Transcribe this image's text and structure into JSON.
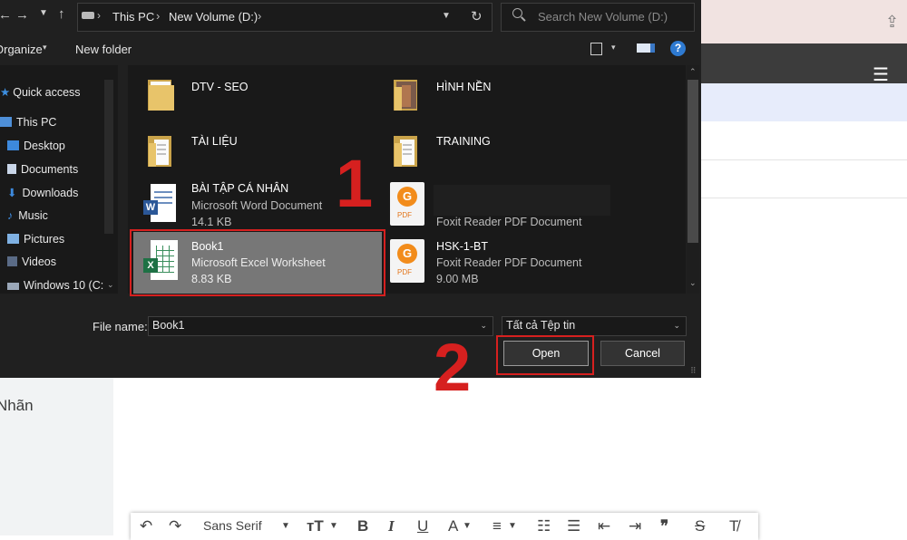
{
  "dialog": {
    "breadcrumb": [
      "This PC",
      "New Volume (D:)"
    ],
    "search_placeholder": "Search New Volume (D:)",
    "toolbar": {
      "organize": "Organize",
      "new_folder": "New folder"
    },
    "nav_items": [
      "Quick access",
      "This PC",
      "Desktop",
      "Documents",
      "Downloads",
      "Music",
      "Pictures",
      "Videos",
      "Windows 10 (C:"
    ],
    "files": [
      {
        "name": "DTV - SEO"
      },
      {
        "name": "HÌNH NỀN"
      },
      {
        "name": "TÀI LIỆU"
      },
      {
        "name": "TRAINING"
      },
      {
        "name": "BÀI TẬP CÁ NHÂN",
        "type": "Microsoft Word Document",
        "size": "14.1 KB"
      },
      {
        "name": "",
        "type": "Foxit Reader PDF Document",
        "size": ""
      },
      {
        "name": "Book1",
        "type": "Microsoft Excel Worksheet",
        "size": "8.83 KB"
      },
      {
        "name": "HSK-1-BT",
        "type": "Foxit Reader PDF Document",
        "size": "9.00 MB"
      }
    ],
    "file_name_label": "File name:",
    "file_name_value": "Book1",
    "file_type_value": "Tất cả Tệp tin",
    "open_label": "Open",
    "cancel_label": "Cancel",
    "pdf_icon_text": "PDF",
    "word_icon_letter": "W",
    "excel_icon_letter": "X"
  },
  "annotations": {
    "step1": "1",
    "step2": "2"
  },
  "background": {
    "side_label": "Nhãn",
    "format_bar": {
      "font_name": "Sans Serif"
    }
  },
  "colors": {
    "highlight_red": "#d6201f",
    "dialog_bg": "#202020",
    "selection": "#777777",
    "folder": "#e8c46a"
  }
}
